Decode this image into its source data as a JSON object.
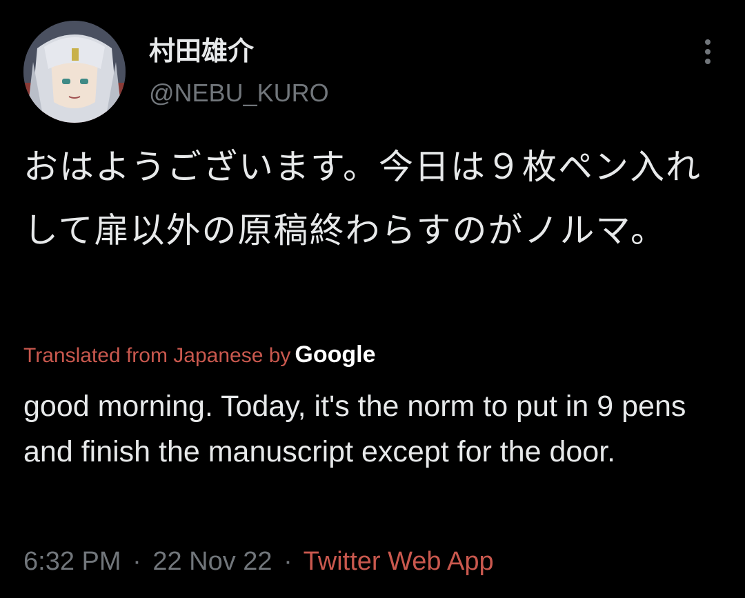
{
  "tweet": {
    "author": {
      "display_name": "村田雄介",
      "handle": "@NEBU_KURO",
      "avatar_icon": "avatar-image"
    },
    "more_icon": "more-vertical-icon",
    "original_text": "おはようございます。今日は９枚ペン入れして扉以外の原稿終わらすのがノルマ。",
    "translation": {
      "label": "Translated from Japanese by",
      "provider": "Google",
      "text": "good morning. Today, it's the norm to put in 9 pens and finish the manuscript except for the door."
    },
    "meta": {
      "time": "6:32 PM",
      "separator": "·",
      "date": "22 Nov 22",
      "source": "Twitter Web App"
    },
    "colors": {
      "background": "#000000",
      "text": "#e7e9ea",
      "muted": "#71767b",
      "accent": "#c9584e"
    }
  }
}
